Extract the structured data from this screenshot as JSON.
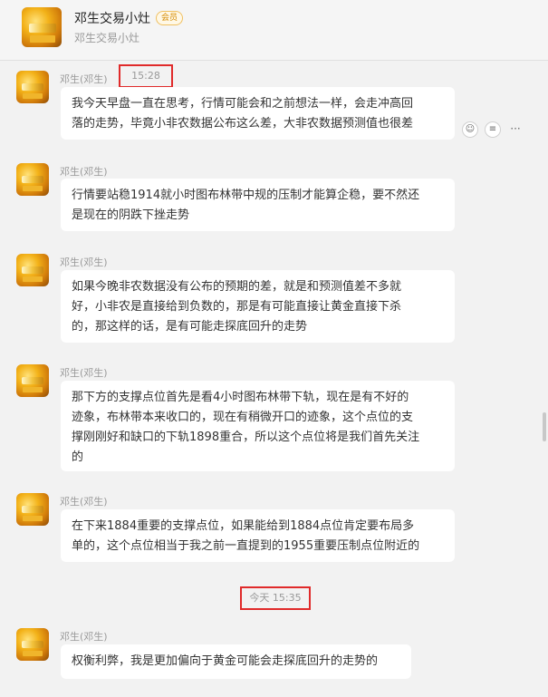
{
  "header": {
    "title": "邓生交易小灶",
    "badge": "会员",
    "subtitle": "邓生交易小灶"
  },
  "messages": [
    {
      "sender": "邓生(邓生)",
      "lines": [
        "我今天早盘一直在思考，行情可能会和之前想法一样，会走冲高回",
        "落的走势，毕竟小非农数据公布这么差，大非农数据预测值也很差"
      ]
    },
    {
      "sender": "邓生(邓生)",
      "lines": [
        "行情要站稳1914就小时图布林带中规的压制才能算企稳，要不然还",
        "是现在的阴跌下挫走势"
      ]
    },
    {
      "sender": "邓生(邓生)",
      "lines": [
        "如果今晚非农数据没有公布的预期的差，就是和预测值差不多就",
        "好，小非农是直接给到负数的，那是有可能直接让黄金直接下杀",
        "的，那这样的话，是有可能走探底回升的走势"
      ]
    },
    {
      "sender": "邓生(邓生)",
      "lines": [
        "那下方的支撑点位首先是看4小时图布林带下轨，现在是有不好的",
        "迹象，布林带本来收口的，现在有稍微开口的迹象，这个点位的支",
        "撑刚刚好和缺口的下轨1898重合，所以这个点位将是我们首先关注",
        "的"
      ]
    },
    {
      "sender": "邓生(邓生)",
      "lines": [
        "在下来1884重要的支撑点位，如果能给到1884点位肯定要布局多",
        "单的，这个点位相当于我之前一直提到的1955重要压制点位附近的"
      ]
    },
    {
      "sender": "邓生(邓生)",
      "lines": [
        "权衡利弊，我是更加偏向于黄金可能会走探底回升的走势的"
      ]
    }
  ],
  "timestamps": {
    "first": "15:28",
    "second": "今天 15:35"
  },
  "actions": {
    "emoji_icon": "smile-icon",
    "reply_icon": "reply-icon",
    "more_label": "···"
  },
  "colors": {
    "highlight_border": "#e02a2a",
    "bubble": "#ffffff",
    "background": "#f2f2f2"
  }
}
